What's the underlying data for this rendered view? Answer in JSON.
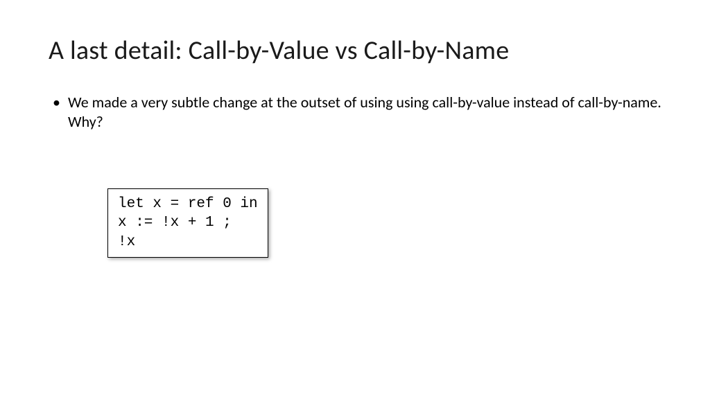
{
  "slide": {
    "title": "A last detail: Call-by-Value vs Call-by-Name",
    "bullet1": "We made a very subtle change at the outset of using using call-by-value instead of call-by-name. Why?",
    "code": "let x = ref 0 in\nx := !x + 1 ;\n!x"
  }
}
